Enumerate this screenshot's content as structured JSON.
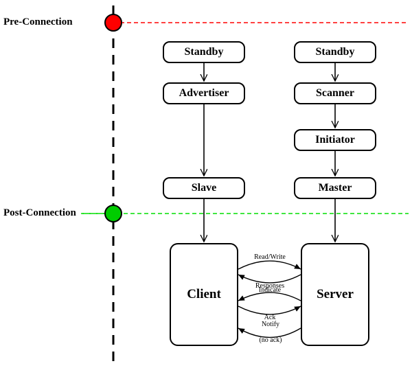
{
  "phases": {
    "pre": "Pre-Connection",
    "post": "Post-Connection"
  },
  "leftColumn": {
    "standby": "Standby",
    "advertiser": "Advertiser",
    "slave": "Slave",
    "client": "Client"
  },
  "rightColumn": {
    "standby": "Standby",
    "scanner": "Scanner",
    "initiator": "Initiator",
    "master": "Master",
    "server": "Server"
  },
  "messages": {
    "readWrite": "Read/Write",
    "responses": "Responses",
    "indicate": "Indicate",
    "ack": "Ack",
    "notify": "Notify",
    "noAck": "(no ack)"
  },
  "colors": {
    "preDot": "#ff0000",
    "postDot": "#00cc00",
    "preLine": "#ff0000",
    "postLine": "#00dd00"
  }
}
